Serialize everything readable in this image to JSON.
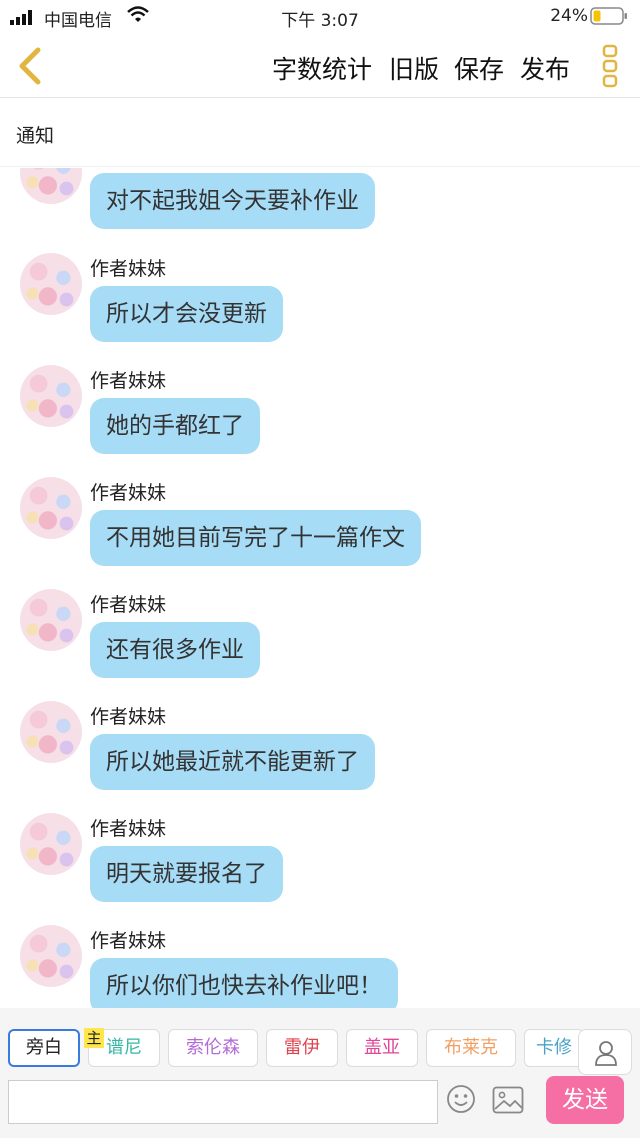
{
  "status_bar": {
    "carrier": "中国电信",
    "time": "下午 3:07",
    "battery": "24%"
  },
  "nav": {
    "word_count": "字数统计",
    "old_version": "旧版",
    "save": "保存",
    "publish": "发布"
  },
  "notice": "通知",
  "messages": [
    {
      "sender": "",
      "text": "对不起我姐今天要补作业"
    },
    {
      "sender": "作者妹妹",
      "text": "所以才会没更新"
    },
    {
      "sender": "作者妹妹",
      "text": "她的手都红了"
    },
    {
      "sender": "作者妹妹",
      "text": "不用她目前写完了十一篇作文"
    },
    {
      "sender": "作者妹妹",
      "text": "还有很多作业"
    },
    {
      "sender": "作者妹妹",
      "text": "所以她最近就不能更新了"
    },
    {
      "sender": "作者妹妹",
      "text": "明天就要报名了"
    },
    {
      "sender": "作者妹妹",
      "text": "所以你们也快去补作业吧！"
    }
  ],
  "roles": [
    {
      "label": "旁白",
      "color": "#222222"
    },
    {
      "label": "谱尼",
      "color": "#35b6a8"
    },
    {
      "label": "索伦森",
      "color": "#b36bd6"
    },
    {
      "label": "雷伊",
      "color": "#e0424f"
    },
    {
      "label": "盖亚",
      "color": "#e0479a"
    },
    {
      "label": "布莱克",
      "color": "#f0a064"
    },
    {
      "label": "卡修",
      "color": "#4aa3c7"
    }
  ],
  "host_badge": "主",
  "input": {
    "value": "",
    "placeholder": ""
  },
  "send": "发送",
  "colors": {
    "bubble": "#a7dcf7",
    "send": "#f56fa4",
    "active_role_border": "#3a7be0"
  },
  "icons": [
    "back-arrow-icon",
    "more-icon",
    "contact-icon",
    "emoji-icon",
    "image-icon"
  ]
}
